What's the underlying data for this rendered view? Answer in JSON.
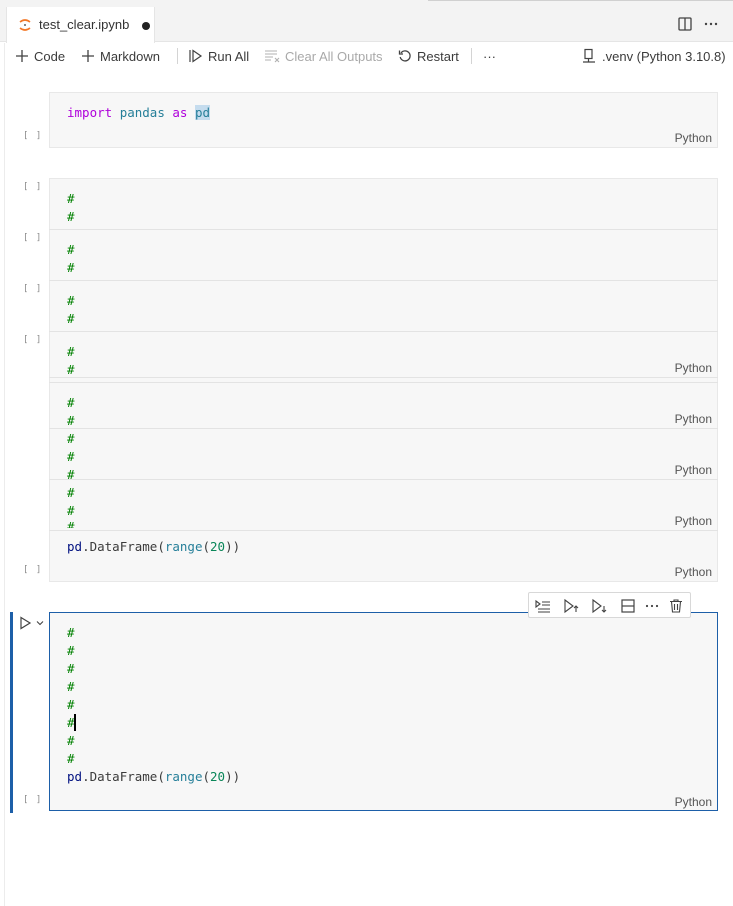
{
  "tab": {
    "title": "test_clear.ipynb"
  },
  "toolbar": {
    "code_label": "Code",
    "markdown_label": "Markdown",
    "run_all_label": "Run All",
    "clear_outputs_label": "Clear All Outputs",
    "restart_label": "Restart",
    "more_label": "···",
    "kernel_label": ".venv (Python 3.10.8)"
  },
  "cells": {
    "exec_empty": "[ ]",
    "language": "Python",
    "cell1": {
      "kw_import": "import",
      "module": "pandas",
      "kw_as": "as",
      "alias": "pd"
    },
    "hash": "#",
    "df_prefix": "pd",
    "df_method": ".DataFrame(",
    "df_func": "range",
    "df_open": "(",
    "df_arg": "20",
    "df_close": "))"
  },
  "cell_toolbar": {
    "more_label": "···"
  },
  "colors": {
    "accent": "#1d5fa8",
    "keyword": "#af00db",
    "comment": "#008000",
    "type": "#267f99"
  }
}
